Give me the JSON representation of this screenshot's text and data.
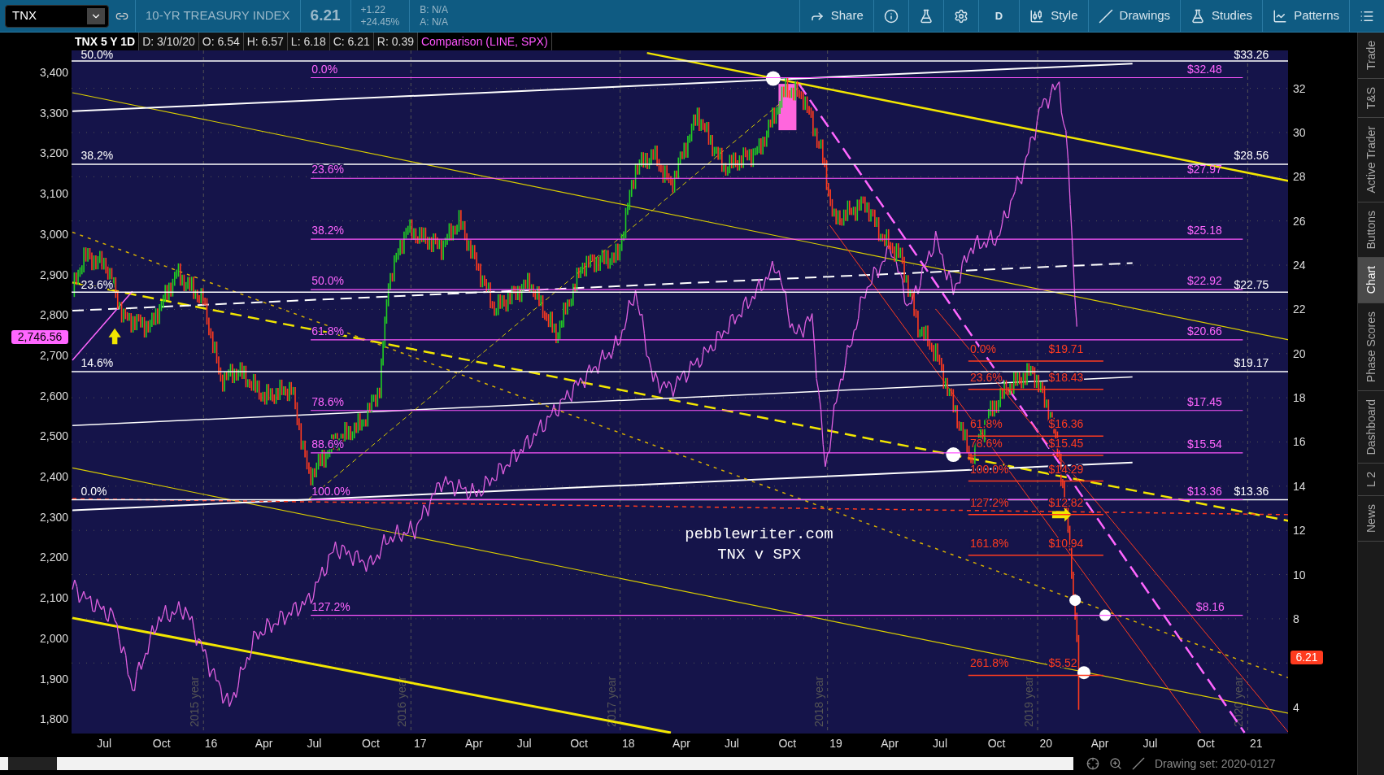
{
  "toolbar": {
    "symbol": "TNX",
    "description": "10-YR TREASURY INDEX",
    "last": "6.21",
    "change": "+1.22",
    "change_pct": "+24.45%",
    "bid": "B: N/A",
    "ask": "A: N/A",
    "buttons": [
      {
        "kind": "share",
        "label": "Share"
      },
      {
        "kind": "info"
      },
      {
        "kind": "flask"
      },
      {
        "kind": "gear"
      },
      {
        "kind": "period",
        "label": "D"
      },
      {
        "kind": "style",
        "label": "Style"
      },
      {
        "kind": "drawings",
        "label": "Drawings"
      },
      {
        "kind": "studies",
        "label": "Studies"
      },
      {
        "kind": "patterns",
        "label": "Patterns"
      },
      {
        "kind": "menu"
      }
    ]
  },
  "legend": {
    "fields": [
      "TNX 5 Y 1D",
      "D: 3/10/20",
      "O: 6.54",
      "H: 6.57",
      "L: 6.18",
      "C: 6.21",
      "R: 0.39"
    ],
    "comparison": "Comparison (LINE, SPX)"
  },
  "chart": {
    "left_axis_ticks": [
      "3,400",
      "3,300",
      "3,200",
      "3,100",
      "3,000",
      "2,900",
      "2,800",
      "2,700",
      "2,600",
      "2,500",
      "2,400",
      "2,300",
      "2,200",
      "2,100",
      "2,000",
      "1,900",
      "1,800"
    ],
    "right_axis_ticks": [
      "32",
      "30",
      "28",
      "26",
      "24",
      "22",
      "20",
      "18",
      "16",
      "14",
      "12",
      "10",
      "8",
      "4"
    ],
    "x_labels": [
      "Jul",
      "Oct",
      "16",
      "Apr",
      "Jul",
      "Oct",
      "17",
      "Apr",
      "Jul",
      "Oct",
      "18",
      "Apr",
      "Jul",
      "Oct",
      "19",
      "Apr",
      "Jul",
      "Oct",
      "20",
      "Apr",
      "Jul",
      "Oct",
      "21"
    ],
    "year_labels": [
      "2015 year",
      "2016 year",
      "2017 year",
      "2018 year",
      "2019 year",
      "2020 year"
    ],
    "left_badge": "2,746.56",
    "right_badge": "6.21",
    "white_levels": [
      {
        "pct": "50.0%",
        "price": "$33.26"
      },
      {
        "pct": "38.2%",
        "price": "$28.56"
      },
      {
        "pct": "23.6%",
        "price": "$22.75"
      },
      {
        "pct": "14.6%",
        "price": "$19.17"
      },
      {
        "pct": "0.0%",
        "price": "$13.36"
      }
    ],
    "magenta_fib": [
      {
        "pct": "0.0%",
        "price": "$32.48"
      },
      {
        "pct": "23.6%",
        "price": "$27.97"
      },
      {
        "pct": "38.2%",
        "price": "$25.18"
      },
      {
        "pct": "50.0%",
        "price": "$22.92"
      },
      {
        "pct": "61.8%",
        "price": "$20.66"
      },
      {
        "pct": "78.6%",
        "price": "$17.45"
      },
      {
        "pct": "88.6%",
        "price": "$15.54"
      },
      {
        "pct": "100.0%",
        "price": "$13.36"
      },
      {
        "pct": "127.2%",
        "price": "$8.16"
      }
    ],
    "red_fib": [
      {
        "pct": "0.0%",
        "price": "$19.71"
      },
      {
        "pct": "23.6%",
        "price": "$18.43"
      },
      {
        "pct": "61.8%",
        "price": "$16.36"
      },
      {
        "pct": "78.6%",
        "price": "$15.45"
      },
      {
        "pct": "100.0%",
        "price": "$14.29"
      },
      {
        "pct": "127.2%",
        "price": "$12.82"
      },
      {
        "pct": "161.8%",
        "price": "$10.94"
      },
      {
        "pct": "261.8%",
        "price": "$5.52"
      }
    ],
    "notes": [
      "pebblewriter.com",
      "TNX v SPX"
    ]
  },
  "sidebar_tabs": [
    {
      "label": "Trade",
      "selected": false
    },
    {
      "label": "T&S",
      "selected": false
    },
    {
      "label": "Active Trader",
      "selected": false
    },
    {
      "label": "Buttons",
      "selected": false
    },
    {
      "label": "Chart",
      "selected": true
    },
    {
      "label": "Phase Scores",
      "selected": false
    },
    {
      "label": "Dashboard",
      "selected": false
    },
    {
      "label": "L 2",
      "selected": false
    },
    {
      "label": "News",
      "selected": false
    }
  ],
  "drawing_set": "Drawing set: 2020-0127"
}
